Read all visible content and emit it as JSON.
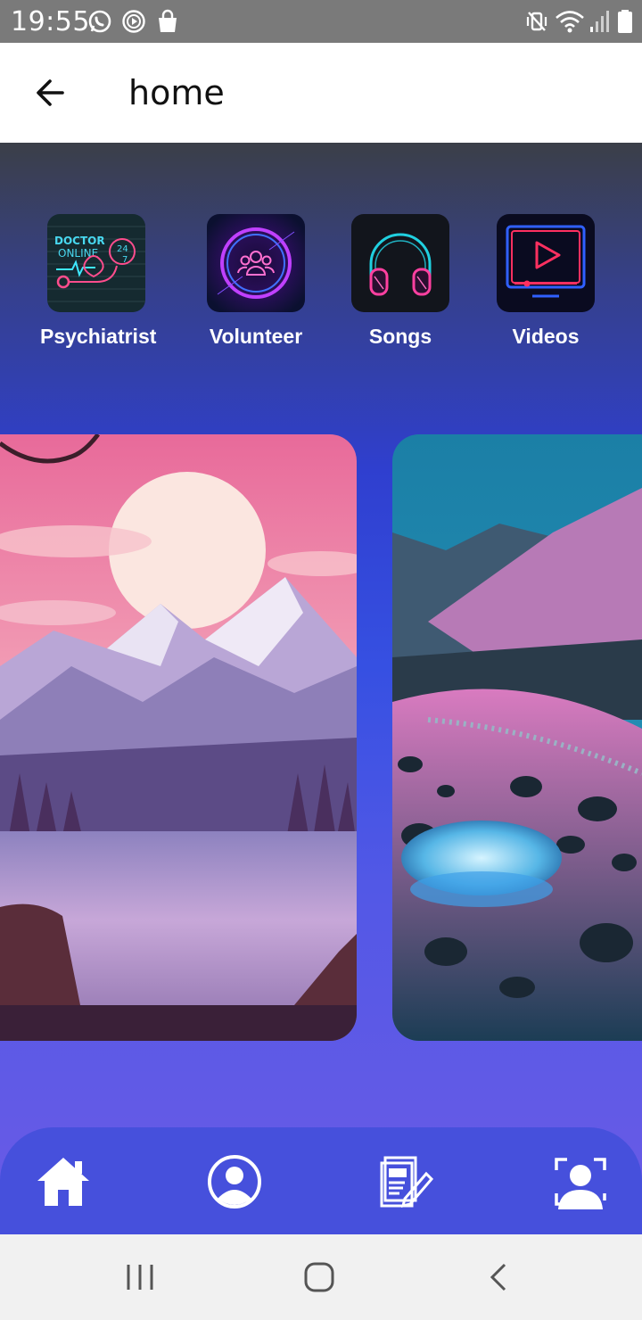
{
  "status_bar": {
    "time": "19:55",
    "left_icons": [
      "whatsapp-icon",
      "media-play-icon",
      "shopping-bag-icon"
    ],
    "right_icons": [
      "vibrate-mute-icon",
      "wifi-icon",
      "signal-icon",
      "battery-icon"
    ]
  },
  "app_bar": {
    "title": "home",
    "back_icon": "arrow-left-icon"
  },
  "shortcuts": [
    {
      "label": "Psychiatrist",
      "icon": "doctor-online-24-7-icon",
      "tile_text": [
        "DOCTOR",
        "ONLINE",
        "24",
        "7"
      ]
    },
    {
      "label": "Volunteer",
      "icon": "group-neon-icon"
    },
    {
      "label": "Songs",
      "icon": "headphones-neon-icon"
    },
    {
      "label": "Videos",
      "icon": "video-play-neon-icon"
    }
  ],
  "carousel": {
    "cards": [
      {
        "image": "pink-moon-mountain-lake"
      },
      {
        "image": "glowing-rock-river-mountains"
      }
    ]
  },
  "bottom_nav": {
    "items": [
      "home-icon",
      "profile-icon",
      "notes-edit-icon",
      "face-scan-icon"
    ]
  },
  "system_nav": [
    "recent-apps-icon",
    "home-circle-icon",
    "back-chevron-icon"
  ],
  "colors": {
    "status_bar": "#7a7a7a",
    "gradient_top": "#3b3f48",
    "gradient_mid": "#2f3fcf",
    "gradient_bottom": "#6b5be6",
    "bottom_nav": "#4650dc",
    "system_nav": "#f1f1f1"
  }
}
